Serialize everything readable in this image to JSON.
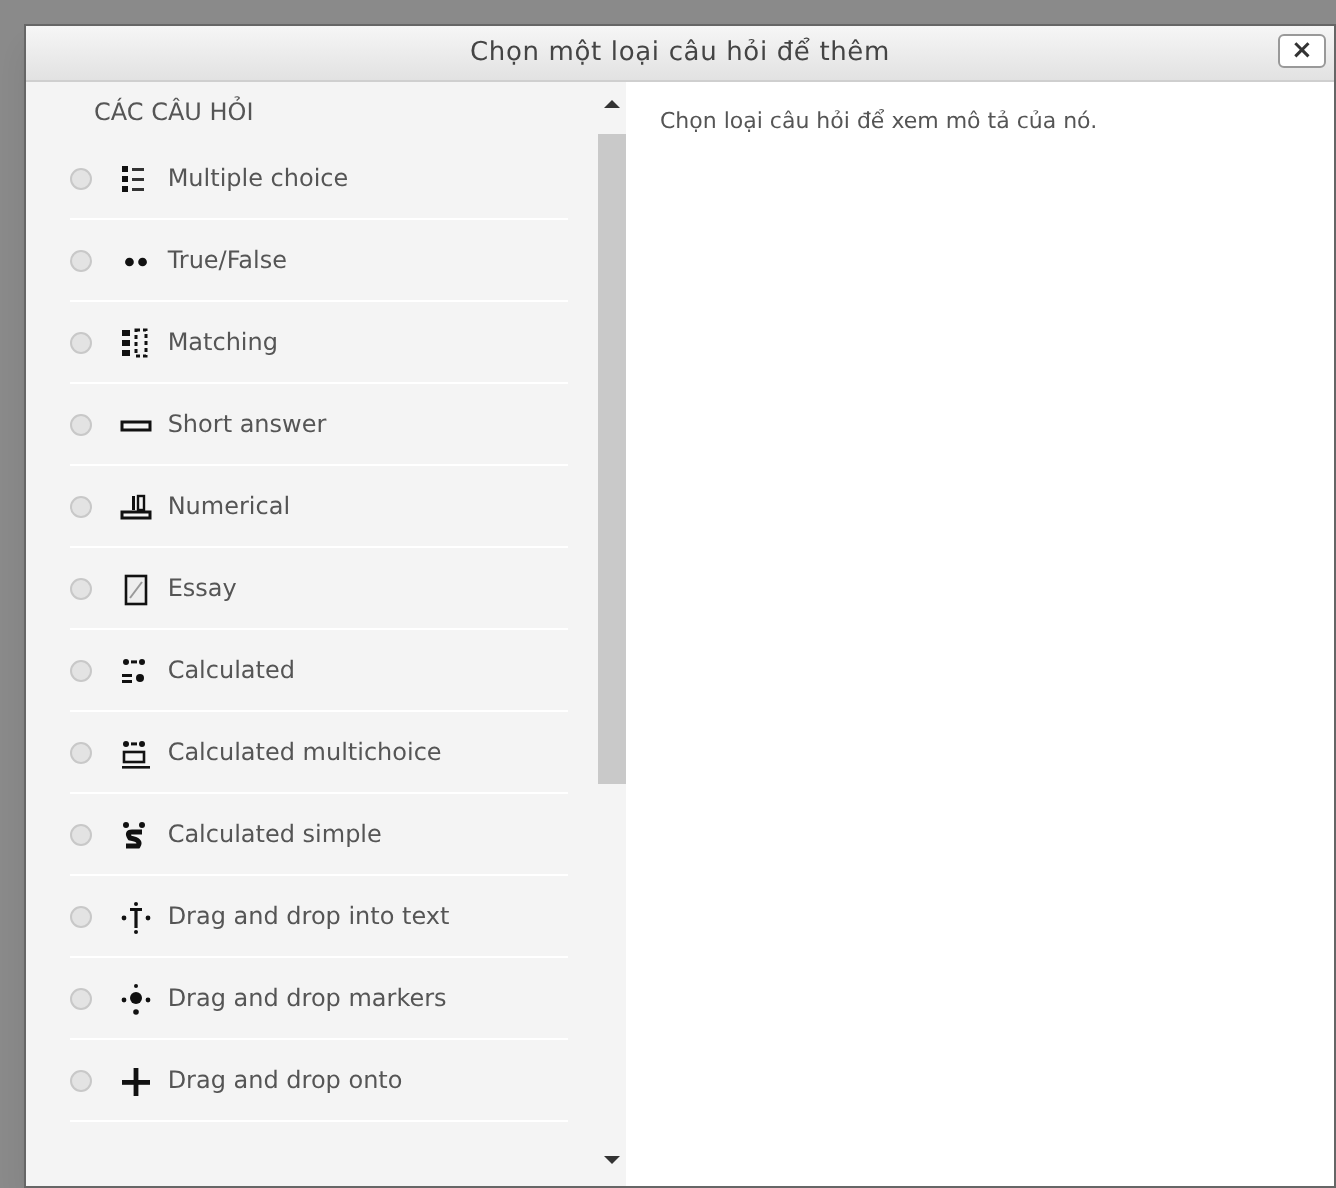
{
  "window": {
    "title": "Chọn một loại câu hỏi để thêm",
    "close": "×"
  },
  "sidebar": {
    "heading": "CÁC CÂU HỎI",
    "items": [
      {
        "label": "Multiple choice",
        "kind": "multichoice",
        "selected": false
      },
      {
        "label": "True/False",
        "kind": "truefalse",
        "selected": false
      },
      {
        "label": "Matching",
        "kind": "match",
        "selected": false
      },
      {
        "label": "Short answer",
        "kind": "shortanswer",
        "selected": false
      },
      {
        "label": "Numerical",
        "kind": "numerical",
        "selected": false
      },
      {
        "label": "Essay",
        "kind": "essay",
        "selected": false
      },
      {
        "label": "Calculated",
        "kind": "calculated",
        "selected": false
      },
      {
        "label": "Calculated multichoice",
        "kind": "calcmulti",
        "selected": false
      },
      {
        "label": "Calculated simple",
        "kind": "calcsimple",
        "selected": false
      },
      {
        "label": "Drag and drop into text",
        "kind": "ddtext",
        "selected": false
      },
      {
        "label": "Drag and drop markers",
        "kind": "ddmarker",
        "selected": false
      },
      {
        "label": "Drag and drop onto",
        "kind": "ddimage",
        "selected": false
      }
    ]
  },
  "description": "Chọn loại câu hỏi để xem mô tả của nó."
}
